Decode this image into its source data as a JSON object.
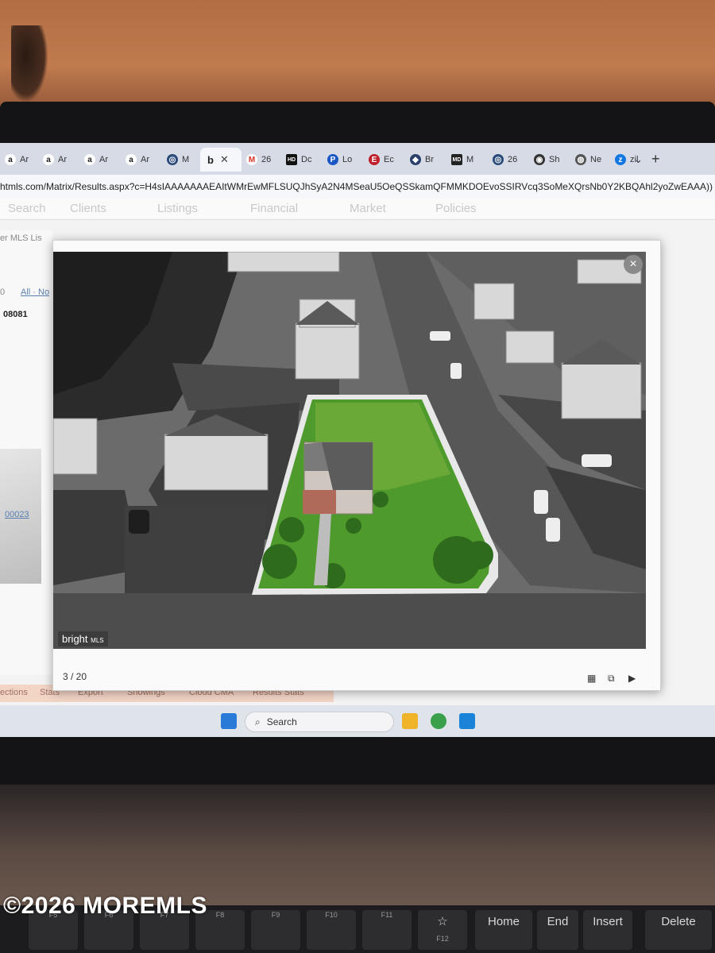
{
  "browser": {
    "tabs": [
      {
        "label": "Ar",
        "icon": "amazon-icon"
      },
      {
        "label": "Ar",
        "icon": "amazon-icon"
      },
      {
        "label": "Ar",
        "icon": "amazon-icon"
      },
      {
        "label": "Ar",
        "icon": "amazon-icon"
      },
      {
        "label": "M",
        "icon": "compass-icon"
      },
      {
        "label": "",
        "icon": "bright-icon",
        "active": true,
        "close": "✕"
      },
      {
        "label": "26",
        "icon": "gmail-icon"
      },
      {
        "label": "Dc",
        "icon": "hd-icon"
      },
      {
        "label": "Lo",
        "icon": "p-icon"
      },
      {
        "label": "Ec",
        "icon": "e-icon"
      },
      {
        "label": "Br",
        "icon": "shield-icon"
      },
      {
        "label": "M",
        "icon": "md-icon"
      },
      {
        "label": "26",
        "icon": "compass-icon"
      },
      {
        "label": "Sh",
        "icon": "globe-icon"
      },
      {
        "label": "Ne",
        "icon": "chrome-icon"
      },
      {
        "label": "zil",
        "icon": "zillow-icon"
      }
    ],
    "tab_bar_chevron": "⌄",
    "new_tab": "+",
    "address": "htmls.com/Matrix/Results.aspx?c=H4sIAAAAAAAEAItWMrEwMFLSUQJhSyA2N4MSeaU5OeQSSkamQFMMKDOEvoSSIRVcq3SoMeXQrsNb0Y2KBQAhl2yoZwEAAA))"
  },
  "page": {
    "nav_items": [
      "Search",
      "Clients",
      "Listings",
      "Financial",
      "Market",
      "Policies"
    ],
    "side": {
      "mls": "er MLS Lis",
      "count": "0",
      "all": "All · No",
      "zip": "08081",
      "link": "00023"
    },
    "bottom_links": [
      "ections",
      "Stats",
      "Export",
      "Showings",
      "Cloud CMA",
      "Results Stats"
    ]
  },
  "modal": {
    "close": "×",
    "counter": "3 / 20",
    "brand": "bright",
    "brand_sub": "MLS",
    "controls": [
      "▦",
      "⧉",
      "▶"
    ]
  },
  "taskbar": {
    "search_placeholder": "Search",
    "apps": [
      "windows-start-icon",
      "file-explorer-icon",
      "chrome-icon",
      "photos-icon"
    ]
  },
  "keyboard": {
    "keys": [
      {
        "label": "",
        "sub": "F5"
      },
      {
        "label": "",
        "sub": "F6"
      },
      {
        "label": "",
        "sub": "F7"
      },
      {
        "label": "",
        "sub": "F8"
      },
      {
        "label": "",
        "sub": "F9"
      },
      {
        "label": "",
        "sub": "F10"
      },
      {
        "label": "",
        "sub": "F11"
      },
      {
        "label": "☆",
        "sub": "F12"
      },
      {
        "label": "Home",
        "sub": ""
      },
      {
        "label": "End",
        "sub": ""
      },
      {
        "label": "Insert",
        "sub": ""
      },
      {
        "label": "Delete",
        "sub": ""
      }
    ]
  },
  "watermark": "©2026 MOREMLS",
  "colors": {
    "tab_bar": "#d6dbe6",
    "grass": "#4f9a2c",
    "bezel": "#141416"
  }
}
